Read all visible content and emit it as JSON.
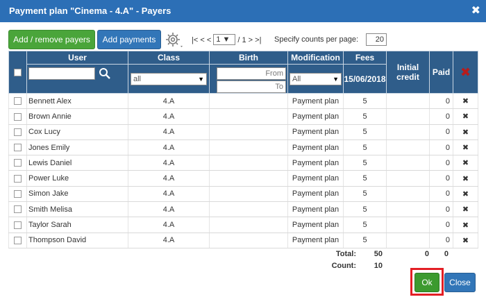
{
  "dialog": {
    "title": "Payment plan \"Cinema - 4.A\" - Payers",
    "close_glyph": "✖"
  },
  "toolbar": {
    "add_remove_label": "Add / remove payers",
    "add_payments_label": "Add payments",
    "gear_icon": "gear-icon"
  },
  "pager": {
    "first": "|<",
    "prev": "< <",
    "current_page": "1",
    "total_pages_text": "/ 1",
    "next": "> >|",
    "counts_label": "Specify counts per page:",
    "counts_value": "20"
  },
  "columns": {
    "user": "User",
    "class": "Class",
    "birth": "Birth",
    "modification": "Modification",
    "fees": "Fees",
    "fees_date": "15/06/2018",
    "initial_credit": "Initial credit",
    "paid": "Paid"
  },
  "filters": {
    "class_selected": "all",
    "birth_from_placeholder": "From",
    "birth_to_placeholder": "To",
    "modification_selected": "All"
  },
  "rows": [
    {
      "user": "Bennett Alex",
      "class": "4.A",
      "modification": "Payment plan",
      "fees": "5",
      "paid": "0"
    },
    {
      "user": "Brown Annie",
      "class": "4.A",
      "modification": "Payment plan",
      "fees": "5",
      "paid": "0"
    },
    {
      "user": "Cox Lucy",
      "class": "4.A",
      "modification": "Payment plan",
      "fees": "5",
      "paid": "0"
    },
    {
      "user": "Jones Emily",
      "class": "4.A",
      "modification": "Payment plan",
      "fees": "5",
      "paid": "0"
    },
    {
      "user": "Lewis Daniel",
      "class": "4.A",
      "modification": "Payment plan",
      "fees": "5",
      "paid": "0"
    },
    {
      "user": "Power Luke",
      "class": "4.A",
      "modification": "Payment plan",
      "fees": "5",
      "paid": "0"
    },
    {
      "user": "Simon Jake",
      "class": "4.A",
      "modification": "Payment plan",
      "fees": "5",
      "paid": "0"
    },
    {
      "user": "Smith Melisa",
      "class": "4.A",
      "modification": "Payment plan",
      "fees": "5",
      "paid": "0"
    },
    {
      "user": "Taylor Sarah",
      "class": "4.A",
      "modification": "Payment plan",
      "fees": "5",
      "paid": "0"
    },
    {
      "user": "Thompson David",
      "class": "4.A",
      "modification": "Payment plan",
      "fees": "5",
      "paid": "0"
    }
  ],
  "totals": {
    "total_label": "Total:",
    "fees_total": "50",
    "initial_credit_total": "0",
    "paid_total": "0",
    "count_label": "Count:",
    "count_value": "10"
  },
  "footer": {
    "ok_label": "Ok",
    "close_label": "Close"
  },
  "colors": {
    "titlebar": "#2c6fb6",
    "header": "#2f5d8a",
    "green_button": "#4aa53a",
    "blue_button": "#3276b8",
    "delete_icon": "#8b1a1a",
    "highlight_frame": "#e31e24"
  }
}
